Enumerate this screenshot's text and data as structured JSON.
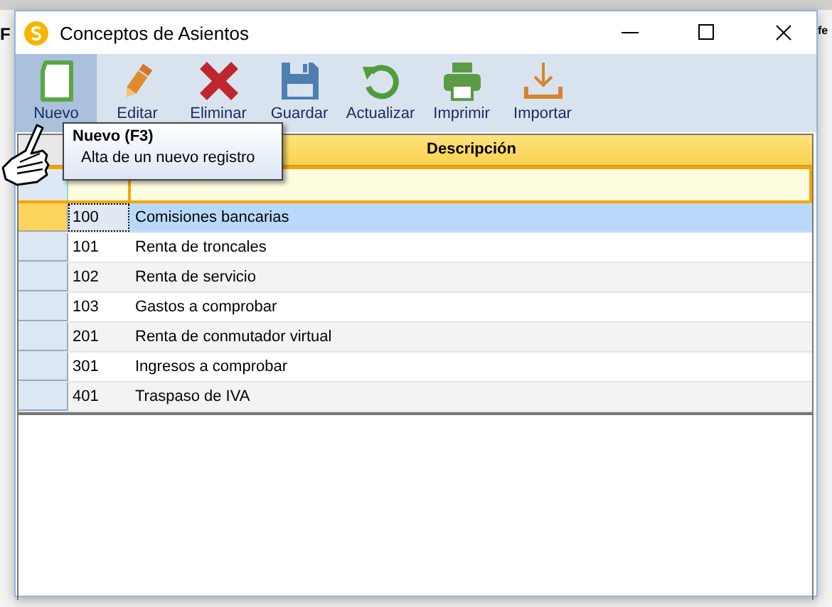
{
  "background": {
    "left_text": "F",
    "right_text": "fe"
  },
  "window": {
    "title": "Conceptos de Asientos"
  },
  "toolbar": [
    {
      "label": "Nuevo",
      "kind": "new",
      "hovered": true
    },
    {
      "label": "Editar",
      "kind": "edit",
      "hovered": false
    },
    {
      "label": "Eliminar",
      "kind": "delete",
      "hovered": false
    },
    {
      "label": "Guardar",
      "kind": "save",
      "hovered": false
    },
    {
      "label": "Actualizar",
      "kind": "refresh",
      "hovered": false
    },
    {
      "label": "Imprimir",
      "kind": "print",
      "hovered": false
    },
    {
      "label": "Importar",
      "kind": "import",
      "hovered": false
    }
  ],
  "tooltip": {
    "title": "Nuevo (F3)",
    "text": "Alta de un nuevo registro"
  },
  "table": {
    "header": "Descripción",
    "rows": [
      {
        "code": "100",
        "description": "Comisiones bancarias",
        "selected": true
      },
      {
        "code": "101",
        "description": "Renta de troncales",
        "selected": false
      },
      {
        "code": "102",
        "description": "Renta de servicio",
        "selected": false
      },
      {
        "code": "103",
        "description": "Gastos a comprobar",
        "selected": false
      },
      {
        "code": "201",
        "description": "Renta de conmutador virtual",
        "selected": false
      },
      {
        "code": "301",
        "description": "Ingresos a comprobar",
        "selected": false
      },
      {
        "code": "401",
        "description": "Traspaso de IVA",
        "selected": false
      }
    ]
  }
}
